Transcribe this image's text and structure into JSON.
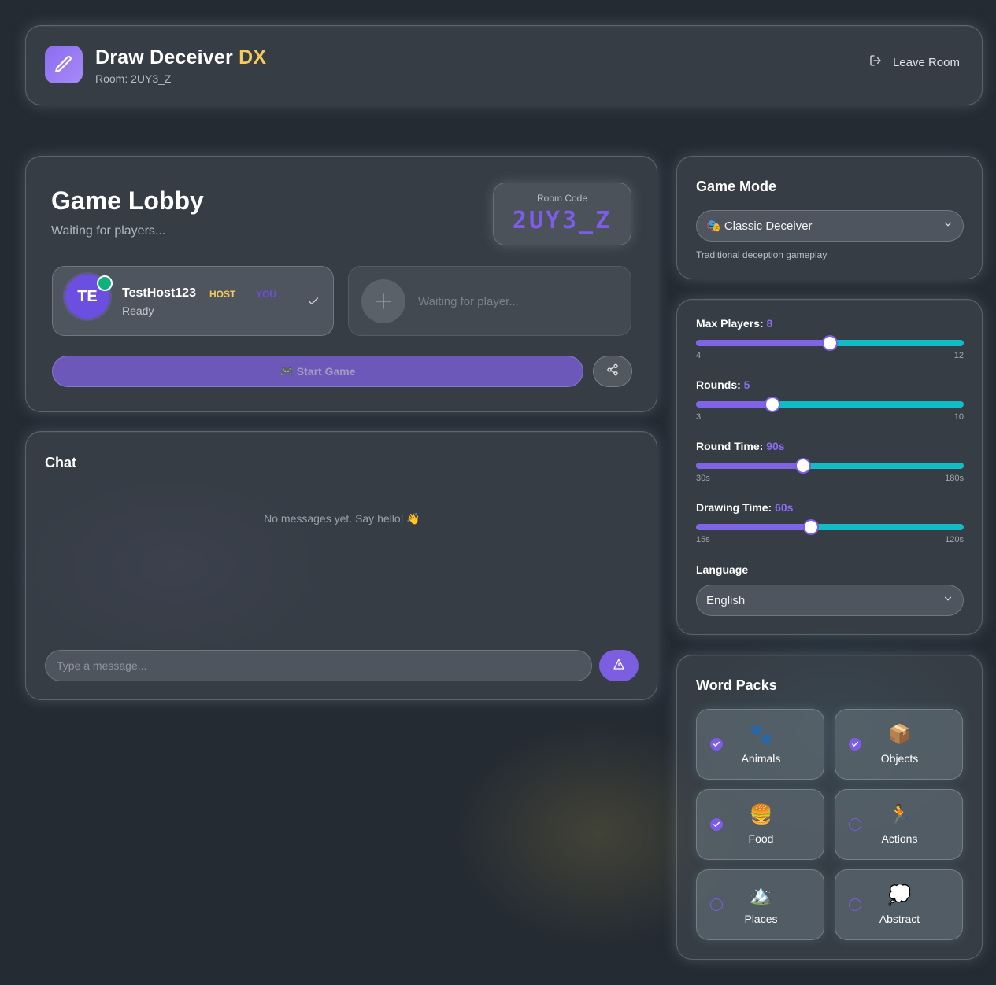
{
  "header": {
    "title_main": "Draw Deceiver",
    "title_accent": "DX",
    "room_line": "Room: 2UY3_Z",
    "leave_label": "Leave Room"
  },
  "lobby": {
    "title": "Game Lobby",
    "subtitle": "Waiting for players...",
    "room_code_label": "Room Code",
    "room_code": "2UY3_Z",
    "players": [
      {
        "initials": "TE",
        "name": "TestHost123",
        "host_tag": "HOST",
        "you_tag": "YOU",
        "status": "Ready"
      }
    ],
    "empty_slot_text": "Waiting for player...",
    "start_label": "🎮 Start Game"
  },
  "chat": {
    "title": "Chat",
    "empty_text": "No messages yet. Say hello! 👋",
    "input_placeholder": "Type a message..."
  },
  "game_mode": {
    "title": "Game Mode",
    "selected": "🎭 Classic Deceiver",
    "description": "Traditional deception gameplay"
  },
  "settings": {
    "sliders": [
      {
        "label": "Max Players:",
        "value": "8",
        "min_label": "4",
        "max_label": "12",
        "fraction": 0.5
      },
      {
        "label": "Rounds:",
        "value": "5",
        "min_label": "3",
        "max_label": "10",
        "fraction": 0.2857
      },
      {
        "label": "Round Time:",
        "value": "90s",
        "min_label": "30s",
        "max_label": "180s",
        "fraction": 0.4
      },
      {
        "label": "Drawing Time:",
        "value": "60s",
        "min_label": "15s",
        "max_label": "120s",
        "fraction": 0.4286
      }
    ],
    "language_label": "Language",
    "language_value": "English"
  },
  "word_packs": {
    "title": "Word Packs",
    "items": [
      {
        "emoji": "🐾",
        "name": "Animals",
        "checked": true
      },
      {
        "emoji": "📦",
        "name": "Objects",
        "checked": true
      },
      {
        "emoji": "🍔",
        "name": "Food",
        "checked": true
      },
      {
        "emoji": "🏃",
        "name": "Actions",
        "checked": false
      },
      {
        "emoji": "🏔️",
        "name": "Places",
        "checked": false
      },
      {
        "emoji": "💭",
        "name": "Abstract",
        "checked": false
      }
    ]
  },
  "colors": {
    "accent": "#7c5ce8",
    "gold": "#f4c95d",
    "teal": "#12bcc6",
    "online": "#12b07e"
  },
  "icons": {
    "logo": "pencil-icon",
    "leave": "logout-icon",
    "ready": "check-icon",
    "empty_slot": "plus-icon",
    "share": "share-icon",
    "send": "send-icon",
    "select": "chevron-down-icon"
  }
}
